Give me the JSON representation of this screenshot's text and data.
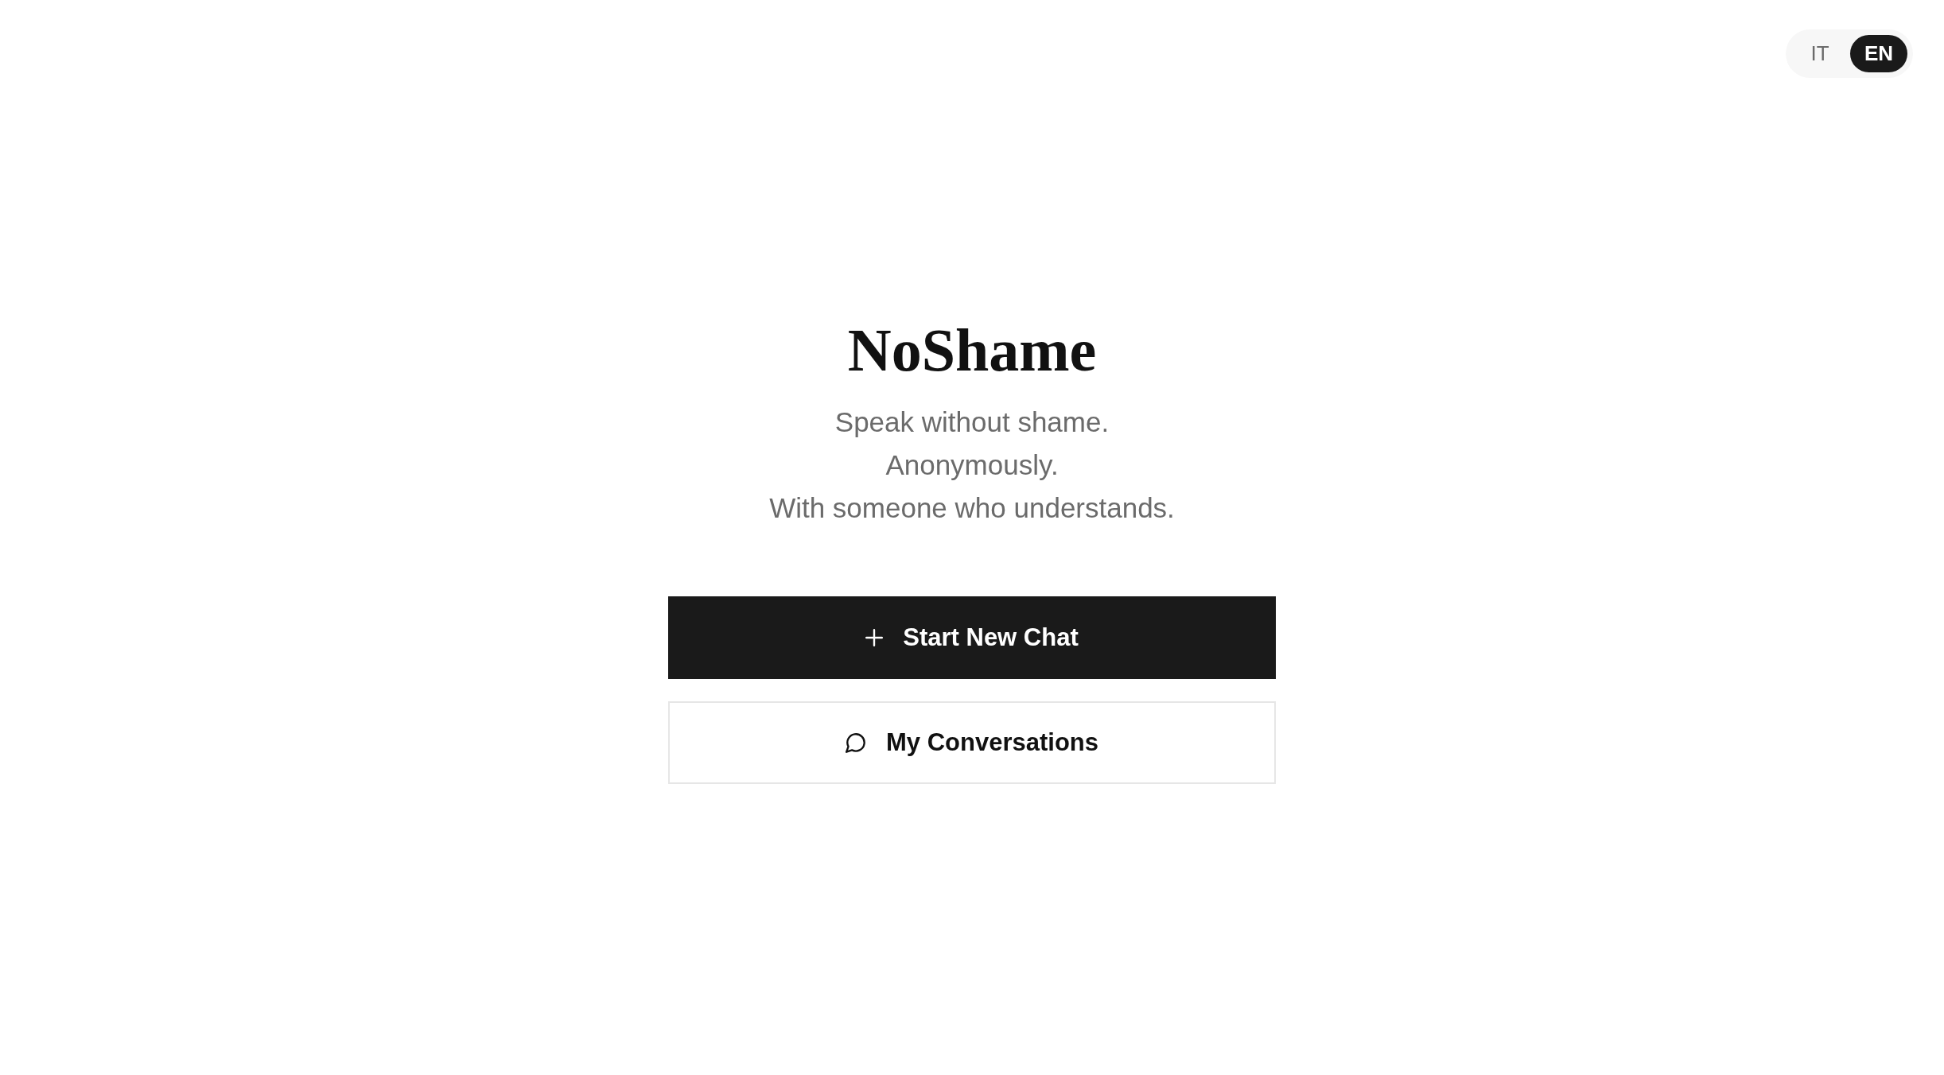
{
  "language_switch": [
    {
      "label": "IT",
      "selected": false
    },
    {
      "label": "EN",
      "selected": true
    }
  ],
  "title": "NoShame",
  "tagline": [
    "Speak without shame.",
    "Anonymously.",
    "With someone who understands."
  ],
  "actions": [
    {
      "label": "Start New Chat",
      "kind": "primary"
    },
    {
      "label": "My Conversations",
      "kind": "secondary"
    }
  ]
}
